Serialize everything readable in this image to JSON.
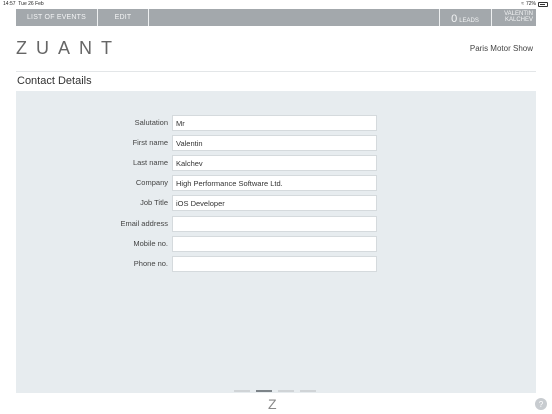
{
  "status_bar": {
    "time": "14:57",
    "date": "Tue 26 Feb",
    "battery": "72%"
  },
  "nav": {
    "list_of_events": "LIST OF EVENTS",
    "edit": "EDIT",
    "leads_count": "0",
    "leads_label": "LEADS",
    "user_first": "VALENTIN",
    "user_last": "KALCHEV"
  },
  "header": {
    "logo": "ZUANT",
    "event_name": "Paris Motor Show"
  },
  "page": {
    "title": "Contact Details"
  },
  "form": {
    "fields": [
      {
        "label": "Salutation",
        "value": "Mr"
      },
      {
        "label": "First name",
        "value": "Valentin"
      },
      {
        "label": "Last name",
        "value": "Kalchev"
      },
      {
        "label": "Company",
        "value": "High Performance Software Ltd."
      },
      {
        "label": "Job Title",
        "value": "iOS Developer"
      },
      {
        "label": "Email address",
        "value": ""
      },
      {
        "label": "Mobile no.",
        "value": ""
      },
      {
        "label": "Phone no.",
        "value": ""
      }
    ]
  },
  "pager": {
    "total": 4,
    "active": 2
  },
  "footer": {
    "logo_mark": "Z",
    "help": "?"
  },
  "icons": {
    "wifi": "wifi-icon",
    "battery": "battery-icon",
    "help": "help-icon"
  }
}
